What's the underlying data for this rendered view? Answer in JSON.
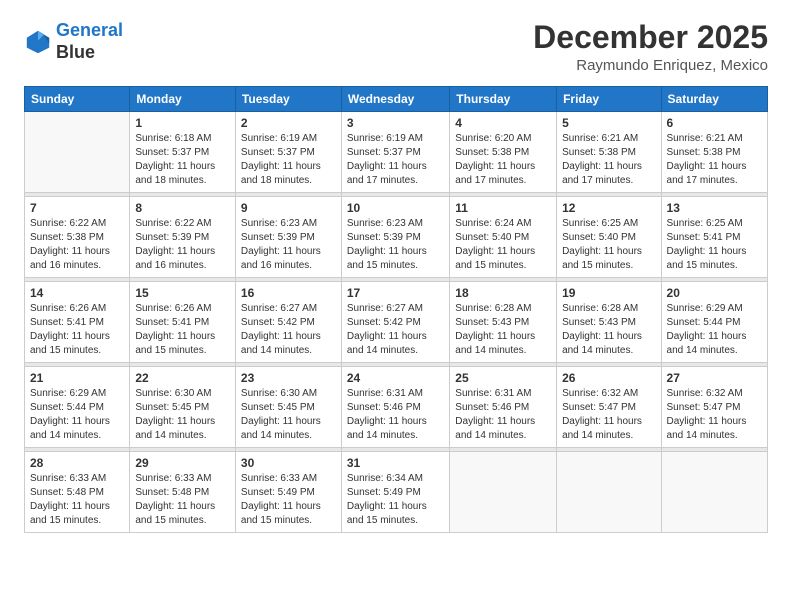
{
  "logo": {
    "line1": "General",
    "line2": "Blue"
  },
  "title": "December 2025",
  "subtitle": "Raymundo Enriquez, Mexico",
  "header_days": [
    "Sunday",
    "Monday",
    "Tuesday",
    "Wednesday",
    "Thursday",
    "Friday",
    "Saturday"
  ],
  "weeks": [
    [
      {
        "day": "",
        "info": ""
      },
      {
        "day": "1",
        "info": "Sunrise: 6:18 AM\nSunset: 5:37 PM\nDaylight: 11 hours\nand 18 minutes."
      },
      {
        "day": "2",
        "info": "Sunrise: 6:19 AM\nSunset: 5:37 PM\nDaylight: 11 hours\nand 18 minutes."
      },
      {
        "day": "3",
        "info": "Sunrise: 6:19 AM\nSunset: 5:37 PM\nDaylight: 11 hours\nand 17 minutes."
      },
      {
        "day": "4",
        "info": "Sunrise: 6:20 AM\nSunset: 5:38 PM\nDaylight: 11 hours\nand 17 minutes."
      },
      {
        "day": "5",
        "info": "Sunrise: 6:21 AM\nSunset: 5:38 PM\nDaylight: 11 hours\nand 17 minutes."
      },
      {
        "day": "6",
        "info": "Sunrise: 6:21 AM\nSunset: 5:38 PM\nDaylight: 11 hours\nand 17 minutes."
      }
    ],
    [
      {
        "day": "7",
        "info": "Sunrise: 6:22 AM\nSunset: 5:38 PM\nDaylight: 11 hours\nand 16 minutes."
      },
      {
        "day": "8",
        "info": "Sunrise: 6:22 AM\nSunset: 5:39 PM\nDaylight: 11 hours\nand 16 minutes."
      },
      {
        "day": "9",
        "info": "Sunrise: 6:23 AM\nSunset: 5:39 PM\nDaylight: 11 hours\nand 16 minutes."
      },
      {
        "day": "10",
        "info": "Sunrise: 6:23 AM\nSunset: 5:39 PM\nDaylight: 11 hours\nand 15 minutes."
      },
      {
        "day": "11",
        "info": "Sunrise: 6:24 AM\nSunset: 5:40 PM\nDaylight: 11 hours\nand 15 minutes."
      },
      {
        "day": "12",
        "info": "Sunrise: 6:25 AM\nSunset: 5:40 PM\nDaylight: 11 hours\nand 15 minutes."
      },
      {
        "day": "13",
        "info": "Sunrise: 6:25 AM\nSunset: 5:41 PM\nDaylight: 11 hours\nand 15 minutes."
      }
    ],
    [
      {
        "day": "14",
        "info": "Sunrise: 6:26 AM\nSunset: 5:41 PM\nDaylight: 11 hours\nand 15 minutes."
      },
      {
        "day": "15",
        "info": "Sunrise: 6:26 AM\nSunset: 5:41 PM\nDaylight: 11 hours\nand 15 minutes."
      },
      {
        "day": "16",
        "info": "Sunrise: 6:27 AM\nSunset: 5:42 PM\nDaylight: 11 hours\nand 14 minutes."
      },
      {
        "day": "17",
        "info": "Sunrise: 6:27 AM\nSunset: 5:42 PM\nDaylight: 11 hours\nand 14 minutes."
      },
      {
        "day": "18",
        "info": "Sunrise: 6:28 AM\nSunset: 5:43 PM\nDaylight: 11 hours\nand 14 minutes."
      },
      {
        "day": "19",
        "info": "Sunrise: 6:28 AM\nSunset: 5:43 PM\nDaylight: 11 hours\nand 14 minutes."
      },
      {
        "day": "20",
        "info": "Sunrise: 6:29 AM\nSunset: 5:44 PM\nDaylight: 11 hours\nand 14 minutes."
      }
    ],
    [
      {
        "day": "21",
        "info": "Sunrise: 6:29 AM\nSunset: 5:44 PM\nDaylight: 11 hours\nand 14 minutes."
      },
      {
        "day": "22",
        "info": "Sunrise: 6:30 AM\nSunset: 5:45 PM\nDaylight: 11 hours\nand 14 minutes."
      },
      {
        "day": "23",
        "info": "Sunrise: 6:30 AM\nSunset: 5:45 PM\nDaylight: 11 hours\nand 14 minutes."
      },
      {
        "day": "24",
        "info": "Sunrise: 6:31 AM\nSunset: 5:46 PM\nDaylight: 11 hours\nand 14 minutes."
      },
      {
        "day": "25",
        "info": "Sunrise: 6:31 AM\nSunset: 5:46 PM\nDaylight: 11 hours\nand 14 minutes."
      },
      {
        "day": "26",
        "info": "Sunrise: 6:32 AM\nSunset: 5:47 PM\nDaylight: 11 hours\nand 14 minutes."
      },
      {
        "day": "27",
        "info": "Sunrise: 6:32 AM\nSunset: 5:47 PM\nDaylight: 11 hours\nand 14 minutes."
      }
    ],
    [
      {
        "day": "28",
        "info": "Sunrise: 6:33 AM\nSunset: 5:48 PM\nDaylight: 11 hours\nand 15 minutes."
      },
      {
        "day": "29",
        "info": "Sunrise: 6:33 AM\nSunset: 5:48 PM\nDaylight: 11 hours\nand 15 minutes."
      },
      {
        "day": "30",
        "info": "Sunrise: 6:33 AM\nSunset: 5:49 PM\nDaylight: 11 hours\nand 15 minutes."
      },
      {
        "day": "31",
        "info": "Sunrise: 6:34 AM\nSunset: 5:49 PM\nDaylight: 11 hours\nand 15 minutes."
      },
      {
        "day": "",
        "info": ""
      },
      {
        "day": "",
        "info": ""
      },
      {
        "day": "",
        "info": ""
      }
    ]
  ]
}
